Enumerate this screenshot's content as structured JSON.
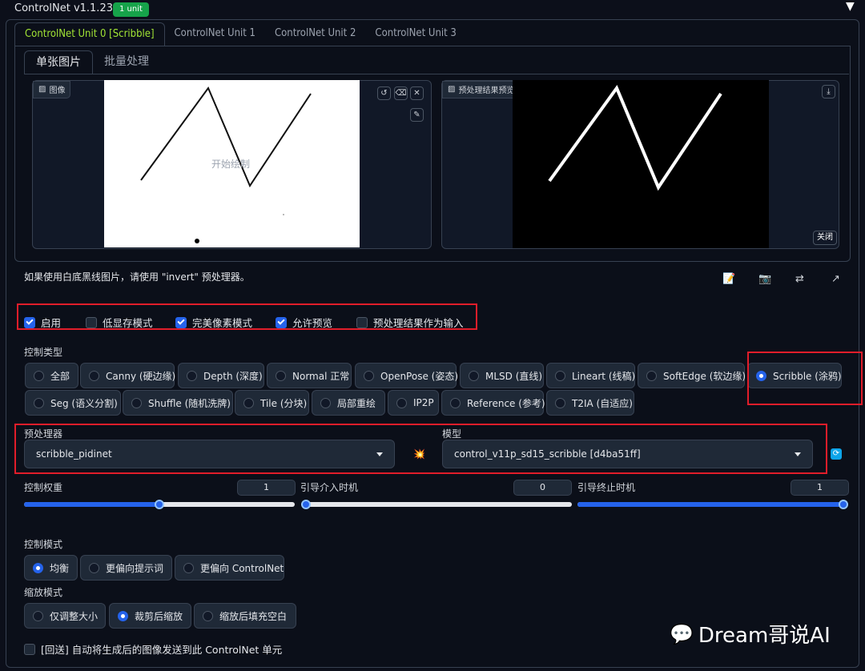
{
  "header": {
    "title": "ControlNet v1.1.238",
    "badge": "1 unit"
  },
  "unit_tabs": [
    "ControlNet Unit 0 [Scribble]",
    "ControlNet Unit 1",
    "ControlNet Unit 2",
    "ControlNet Unit 3"
  ],
  "sub_tabs": [
    "单张图片",
    "批量处理"
  ],
  "image_panel": {
    "label": "图像",
    "canvas_hint": "开始绘制"
  },
  "preview_panel": {
    "label": "预处理结果预览",
    "close_label": "关闭"
  },
  "note": "如果使用白底黑线图片，请使用 \"invert\" 预处理器。",
  "toolbar_icons": [
    "memo-icon",
    "camera-icon",
    "swap-icon",
    "send-icon"
  ],
  "options": [
    {
      "label": "启用",
      "checked": true
    },
    {
      "label": "低显存模式",
      "checked": false
    },
    {
      "label": "完美像素模式",
      "checked": true
    },
    {
      "label": "允许预览",
      "checked": true
    },
    {
      "label": "预处理结果作为输入",
      "checked": false
    }
  ],
  "control_type": {
    "label": "控制类型",
    "items": [
      "全部",
      "Canny (硬边缘)",
      "Depth (深度)",
      "Normal 正常",
      "OpenPose (姿态)",
      "MLSD (直线)",
      "Lineart (线稿)",
      "SoftEdge (软边缘)",
      "Scribble (涂鸦)",
      "Seg (语义分割)",
      "Shuffle (随机洗牌)",
      "Tile (分块)",
      "局部重绘",
      "IP2P",
      "Reference (参考)",
      "T2IA (自适应)"
    ],
    "selected": "Scribble (涂鸦)"
  },
  "preprocessor": {
    "label": "预处理器",
    "value": "scribble_pidinet"
  },
  "model": {
    "label": "模型",
    "value": "control_v11p_sd15_scribble [d4ba51ff]"
  },
  "sliders": [
    {
      "label": "控制权重",
      "value": "1",
      "fraction": 0.5
    },
    {
      "label": "引导介入时机",
      "value": "0",
      "fraction": 0.0
    },
    {
      "label": "引导终止时机",
      "value": "1",
      "fraction": 1.0
    }
  ],
  "control_mode": {
    "label": "控制模式",
    "items": [
      "均衡",
      "更偏向提示词",
      "更偏向 ControlNet"
    ],
    "selected": "均衡"
  },
  "resize_mode": {
    "label": "缩放模式",
    "items": [
      "仅调整大小",
      "裁剪后缩放",
      "缩放后填充空白"
    ],
    "selected": "裁剪后缩放"
  },
  "loopback": {
    "label": "[回送] 自动将生成后的图像发送到此 ControlNet 单元",
    "checked": false
  },
  "watermark": "Dream哥说AI"
}
